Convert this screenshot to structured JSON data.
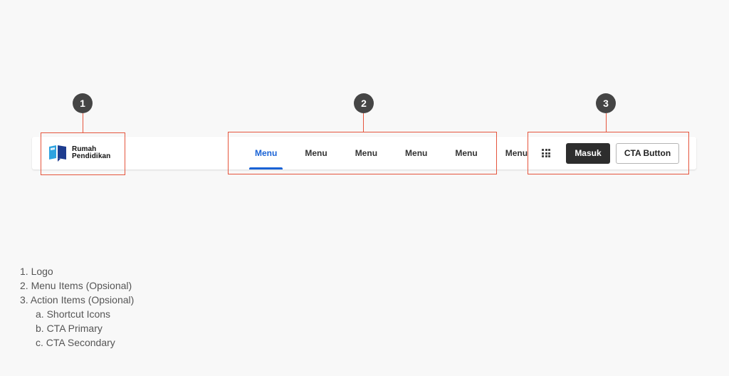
{
  "navbar": {
    "logo": {
      "line1": "Rumah",
      "line2": "Pendidikan",
      "icon": "book-icon",
      "colors": {
        "left_page": "#2ea3e0",
        "right_page": "#1d3c8f"
      }
    },
    "menu_items": [
      {
        "label": "Menu",
        "active": true
      },
      {
        "label": "Menu",
        "active": false
      },
      {
        "label": "Menu",
        "active": false
      },
      {
        "label": "Menu",
        "active": false
      },
      {
        "label": "Menu",
        "active": false
      },
      {
        "label": "Menu",
        "active": false
      }
    ],
    "actions": {
      "shortcut_icon": "apps-grid-icon",
      "primary_label": "Masuk",
      "secondary_label": "CTA Button"
    }
  },
  "annotations": {
    "markers": [
      "1",
      "2",
      "3"
    ],
    "color": "#e5553d"
  },
  "legend": [
    "1. Logo",
    "2. Menu Items (Opsional)",
    "3. Action Items (Opsional)",
    "a. Shortcut Icons",
    "b. CTA Primary",
    "c. CTA Secondary"
  ],
  "colors": {
    "accent": "#1a63d6",
    "primary_button": "#2d2d2d",
    "marker": "#454545",
    "background": "#f8f8f8"
  }
}
